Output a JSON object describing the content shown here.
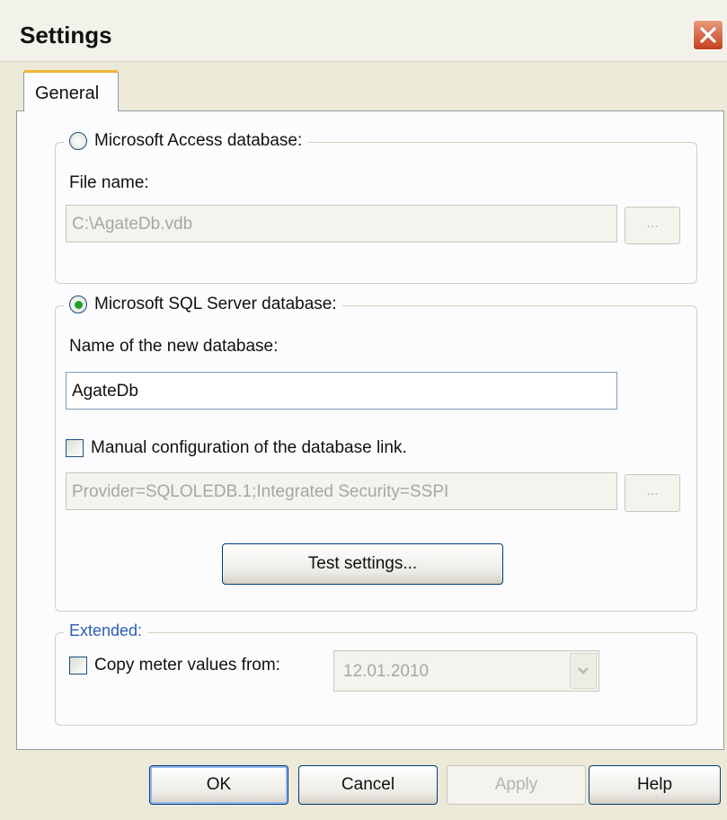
{
  "window": {
    "title": "Settings"
  },
  "tabs": [
    {
      "label": "General"
    }
  ],
  "access": {
    "option_label": "Microsoft Access database:",
    "file_name_label": "File name:",
    "file_name_value": "C:\\AgateDb.vdb",
    "browse_label": "..."
  },
  "sql": {
    "option_label": "Microsoft SQL Server database:",
    "db_name_label": "Name of the new database:",
    "db_name_value": "AgateDb",
    "manual_config_label": "Manual configuration of the database link.",
    "connection_value": "Provider=SQLOLEDB.1;Integrated Security=SSPI",
    "browse_label": "...",
    "test_button_label": "Test settings..."
  },
  "extended": {
    "group_label": "Extended:",
    "copy_meter_label": "Copy meter values from:",
    "date_value": "12.01.2010"
  },
  "buttons": {
    "ok": "OK",
    "cancel": "Cancel",
    "apply": "Apply",
    "help": "Help"
  },
  "state": {
    "selected_database": "sql",
    "manual_config_checked": false,
    "copy_meter_checked": false
  },
  "colors": {
    "close_button": "#c4401f",
    "tab_accent": "#f0b43a",
    "group_label_extended": "#2d5db6",
    "radio_selected": "#21a121"
  },
  "icons": {
    "close": "close-icon",
    "radio_on": "radio-checked-icon",
    "radio_off": "radio-unchecked-icon",
    "dropdown": "chevron-down-icon"
  }
}
